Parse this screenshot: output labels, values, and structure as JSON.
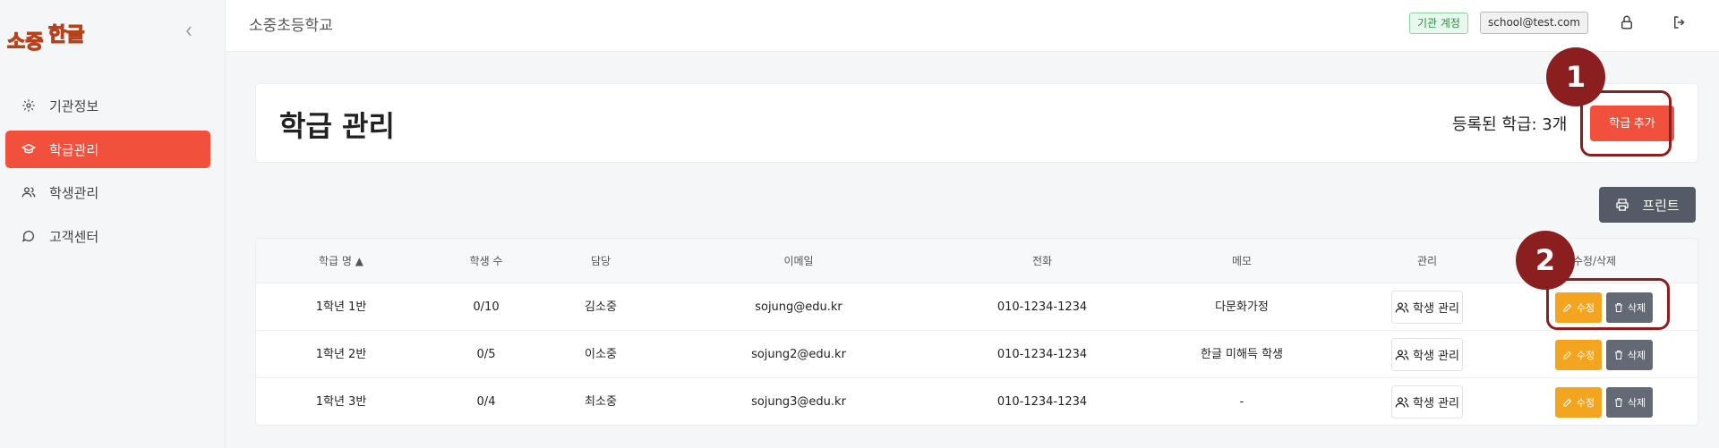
{
  "app": {
    "logo_text": "소중한글",
    "collapse_icon": "chevron-left-icon"
  },
  "sidebar": {
    "items": [
      {
        "label": "기관정보",
        "icon": "gear-icon",
        "active": false
      },
      {
        "label": "학급관리",
        "icon": "graduation-cap-icon",
        "active": true
      },
      {
        "label": "학생관리",
        "icon": "users-icon",
        "active": false
      },
      {
        "label": "고객센터",
        "icon": "chat-bubble-icon",
        "active": false
      }
    ]
  },
  "header": {
    "school_name": "소중초등학교",
    "account_type": "기관 계정",
    "email": "school@test.com",
    "icons": [
      "lock-icon",
      "logout-icon"
    ]
  },
  "main": {
    "title": "학급 관리",
    "registered_count": "등록된 학급: 3개",
    "add_button": "학급 추가",
    "print_button": "프린트"
  },
  "annotations": [
    "1",
    "2"
  ],
  "table": {
    "headers": [
      "학급 명 ▲",
      "학생 수",
      "담당",
      "이메일",
      "전화",
      "메모",
      "관리",
      "수정/삭제"
    ],
    "rows": [
      {
        "name": "1학년 1반",
        "students": "0/10",
        "teacher": "김소중",
        "email": "sojung@edu.kr",
        "phone": "010-1234-1234",
        "memo": "다문화가정"
      },
      {
        "name": "1학년 2반",
        "students": "0/5",
        "teacher": "이소중",
        "email": "sojung2@edu.kr",
        "phone": "010-1234-1234",
        "memo": "한글 미해득 학생"
      },
      {
        "name": "1학년 3반",
        "students": "0/4",
        "teacher": "최소중",
        "email": "sojung3@edu.kr",
        "phone": "010-1234-1234",
        "memo": "-"
      }
    ],
    "manage_label": "학생 관리",
    "edit_label": "수정",
    "delete_label": "삭제"
  },
  "colors": {
    "accent": "#f0503c",
    "edit": "#f3a51f",
    "delete": "#636a76",
    "annotation": "#8b1e1e"
  }
}
